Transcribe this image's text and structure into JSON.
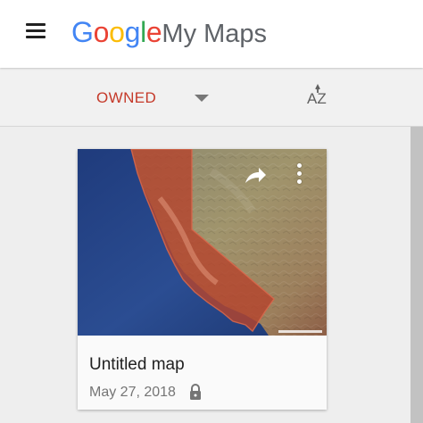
{
  "header": {
    "logo_letters": [
      {
        "char": "G",
        "color": "#4285F4"
      },
      {
        "char": "o",
        "color": "#EA4335"
      },
      {
        "char": "o",
        "color": "#FBBC05"
      },
      {
        "char": "g",
        "color": "#4285F4"
      },
      {
        "char": "l",
        "color": "#34A853"
      },
      {
        "char": "e",
        "color": "#EA4335"
      }
    ],
    "product_name": "My Maps",
    "menu_icon": "hamburger-menu-icon"
  },
  "toolbar": {
    "filter_label": "OWNED",
    "filter_icon": "dropdown-arrow-icon",
    "sort_label": "AZ",
    "sort_icon": "sort-alpha-icon",
    "accent_color": "#C53929"
  },
  "maps": [
    {
      "title": "Untitled map",
      "date": "May 27, 2018",
      "privacy_icon": "lock-icon",
      "share_icon": "share-icon",
      "more_icon": "more-vert-icon"
    }
  ]
}
